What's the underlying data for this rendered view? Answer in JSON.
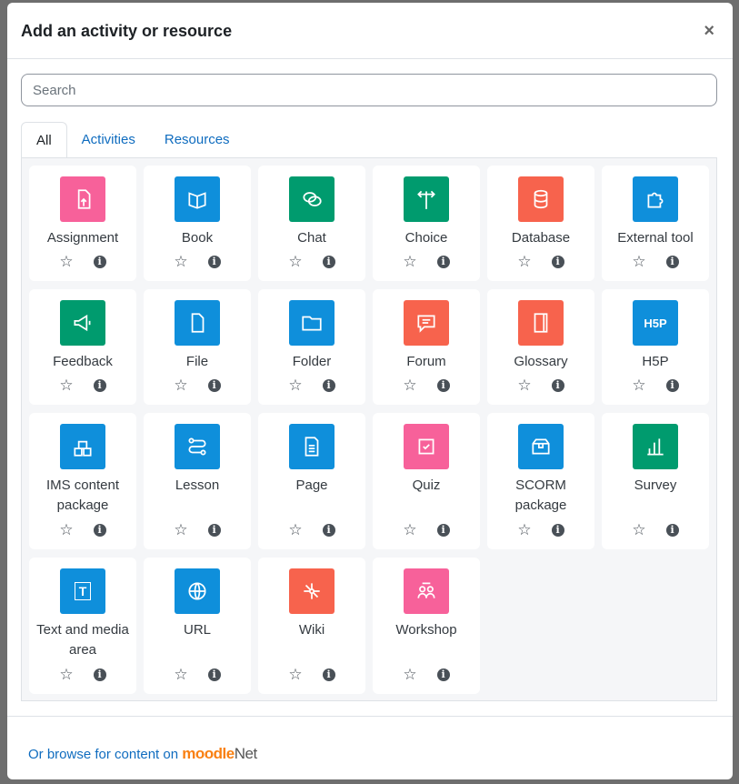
{
  "modal": {
    "title": "Add an activity or resource",
    "close_icon": "×"
  },
  "search": {
    "placeholder": "Search",
    "value": ""
  },
  "tabs": [
    {
      "label": "All",
      "active": true
    },
    {
      "label": "Activities"
    },
    {
      "label": "Resources"
    }
  ],
  "colors": {
    "assessment": "#f7619a",
    "content": "#0f8fdb",
    "collaboration": "#009b6e",
    "communication": "#f7634d"
  },
  "items": [
    {
      "label": "Assignment",
      "color": "#f7619a",
      "icon": "file-upload-icon"
    },
    {
      "label": "Book",
      "color": "#0f8fdb",
      "icon": "book-icon"
    },
    {
      "label": "Chat",
      "color": "#009b6e",
      "icon": "chat-icon"
    },
    {
      "label": "Choice",
      "color": "#009b6e",
      "icon": "signpost-icon"
    },
    {
      "label": "Database",
      "color": "#f7634d",
      "icon": "database-icon"
    },
    {
      "label": "External tool",
      "color": "#0f8fdb",
      "icon": "puzzle-icon"
    },
    {
      "label": "Feedback",
      "color": "#009b6e",
      "icon": "megaphone-icon"
    },
    {
      "label": "File",
      "color": "#0f8fdb",
      "icon": "file-icon"
    },
    {
      "label": "Folder",
      "color": "#0f8fdb",
      "icon": "folder-icon"
    },
    {
      "label": "Forum",
      "color": "#f7634d",
      "icon": "forum-icon"
    },
    {
      "label": "Glossary",
      "color": "#f7634d",
      "icon": "glossary-icon"
    },
    {
      "label": "H5P",
      "color": "#0f8fdb",
      "icon": "h5p-icon",
      "glyph": "H5P"
    },
    {
      "label": "IMS content package",
      "color": "#0f8fdb",
      "icon": "package-icon"
    },
    {
      "label": "Lesson",
      "color": "#0f8fdb",
      "icon": "lesson-icon"
    },
    {
      "label": "Page",
      "color": "#0f8fdb",
      "icon": "page-icon"
    },
    {
      "label": "Quiz",
      "color": "#f7619a",
      "icon": "quiz-icon"
    },
    {
      "label": "SCORM package",
      "color": "#0f8fdb",
      "icon": "scorm-icon"
    },
    {
      "label": "Survey",
      "color": "#009b6e",
      "icon": "bar-chart-icon"
    },
    {
      "label": "Text and media area",
      "color": "#0f8fdb",
      "icon": "text-icon",
      "glyph": "T"
    },
    {
      "label": "URL",
      "color": "#0f8fdb",
      "icon": "globe-icon"
    },
    {
      "label": "Wiki",
      "color": "#f7634d",
      "icon": "wiki-icon"
    },
    {
      "label": "Workshop",
      "color": "#f7619a",
      "icon": "workshop-icon"
    }
  ],
  "footer": {
    "browse_text": "Or browse for content on",
    "moodlenet_logo": "moodleNet"
  }
}
